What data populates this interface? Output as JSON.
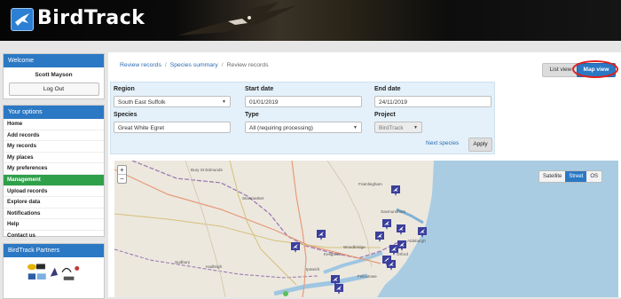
{
  "header": {
    "app_name": "BirdTrack",
    "logo_icon": "swallow-logo-icon",
    "hero_image": "osprey-in-flight"
  },
  "welcome": {
    "title": "Welcome",
    "user_name": "Scott Mayson",
    "logout_label": "Log Out"
  },
  "options": {
    "title": "Your options",
    "items": [
      {
        "label": "Home"
      },
      {
        "label": "Add records"
      },
      {
        "label": "My records"
      },
      {
        "label": "My places"
      },
      {
        "label": "My preferences"
      },
      {
        "label": "Management"
      },
      {
        "label": "Upload records"
      },
      {
        "label": "Explore data"
      },
      {
        "label": "Notifications"
      },
      {
        "label": "Help"
      },
      {
        "label": "Contact us"
      }
    ],
    "active_item": "Management"
  },
  "partners": {
    "title": "BirdTrack Partners",
    "logos": [
      "bto-logo",
      "rspb-logo",
      "birdwatch-ireland-logo",
      "soc-logo",
      "waos-logo"
    ]
  },
  "breadcrumb": {
    "items": [
      "Review records",
      "Species summary"
    ],
    "current": "Review records"
  },
  "view_toggle": {
    "list_label": "List view",
    "map_label": "Map view",
    "selected": "Map view"
  },
  "filters": {
    "region": {
      "label": "Region",
      "value": "South East Suffolk"
    },
    "start_date": {
      "label": "Start date",
      "value": "01/01/2019"
    },
    "end_date": {
      "label": "End date",
      "value": "24/11/2019"
    },
    "species": {
      "label": "Species",
      "value": "Great White Egret"
    },
    "type": {
      "label": "Type",
      "value": "All (requiring processing)"
    },
    "project": {
      "label": "Project",
      "value": "BirdTrack"
    },
    "next_species_label": "Next species",
    "apply_label": "Apply"
  },
  "map": {
    "zoom_in_label": "+",
    "zoom_out_label": "−",
    "layers": [
      "Satellite",
      "Street",
      "OS"
    ],
    "active_layer": "Street",
    "places": [
      "Bury St Edmunds",
      "Stowmarket",
      "Framlingham",
      "Saxmundham",
      "Woodbridge",
      "Hadleigh",
      "Sudbury",
      "Kesgrave",
      "Felixstowe",
      "Aldeburgh",
      "Orford",
      "Ipswich"
    ]
  },
  "colors": {
    "accent": "#2b78c4",
    "active_menu": "#2fa04a",
    "marker": "#3b3f9c",
    "highlight": "#e0201c",
    "sea": "#a9cce3"
  }
}
